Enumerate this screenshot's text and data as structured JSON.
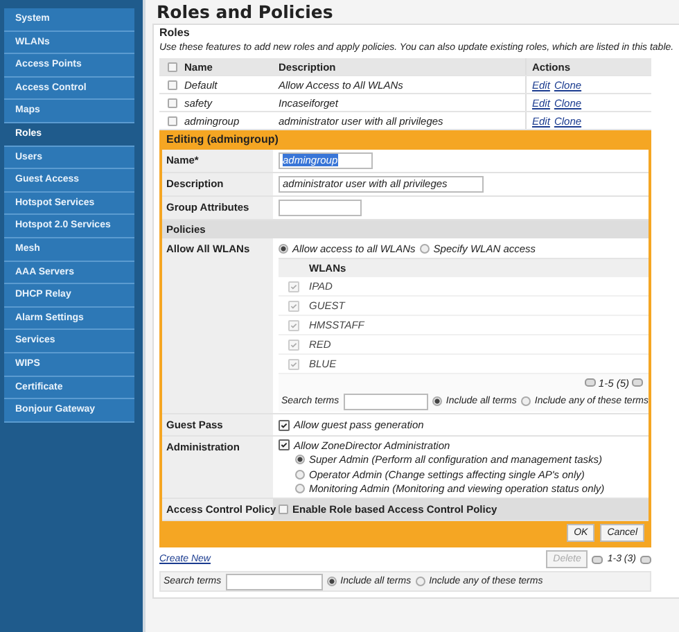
{
  "sidebar": {
    "items": [
      {
        "label": "System",
        "selected": false
      },
      {
        "label": "WLANs",
        "selected": false
      },
      {
        "label": "Access Points",
        "selected": false
      },
      {
        "label": "Access Control",
        "selected": false
      },
      {
        "label": "Maps",
        "selected": false
      },
      {
        "label": "Roles",
        "selected": true
      },
      {
        "label": "Users",
        "selected": false
      },
      {
        "label": "Guest Access",
        "selected": false
      },
      {
        "label": "Hotspot Services",
        "selected": false
      },
      {
        "label": "Hotspot 2.0 Services",
        "selected": false
      },
      {
        "label": "Mesh",
        "selected": false
      },
      {
        "label": "AAA Servers",
        "selected": false
      },
      {
        "label": "DHCP Relay",
        "selected": false
      },
      {
        "label": "Alarm Settings",
        "selected": false
      },
      {
        "label": "Services",
        "selected": false
      },
      {
        "label": "WIPS",
        "selected": false
      },
      {
        "label": "Certificate",
        "selected": false
      },
      {
        "label": "Bonjour Gateway",
        "selected": false
      }
    ]
  },
  "page_title": "Roles and Policies",
  "section_title": "Roles",
  "intro": "Use these features to add new roles and apply policies. You can also update existing roles, which are listed in this table.",
  "roles_table": {
    "columns": [
      "Name",
      "Description",
      "Actions"
    ],
    "header_checked": false,
    "rows": [
      {
        "checked": false,
        "name": "Default",
        "description": "Allow Access to All WLANs",
        "actions": [
          "Edit",
          "Clone"
        ]
      },
      {
        "checked": false,
        "name": "safety",
        "description": "Incaseiforget",
        "actions": [
          "Edit",
          "Clone"
        ]
      },
      {
        "checked": false,
        "name": "admingroup",
        "description": "administrator user with all privileges",
        "actions": [
          "Edit",
          "Clone"
        ]
      }
    ]
  },
  "editor": {
    "title": "Editing (admingroup)",
    "fields": [
      {
        "label": "Name*",
        "value": "admingroup",
        "kind": "selected"
      },
      {
        "label": "Description",
        "value": "administrator user with all privileges",
        "kind": "wide"
      },
      {
        "label": "Group Attributes",
        "kind": "short"
      }
    ],
    "policies_title": "Policies",
    "allow_all_label": "Allow All WLANs",
    "allow_options": [
      {
        "label": "Allow access to all WLANs",
        "selected": true
      },
      {
        "label": "Specify WLAN access",
        "selected": false
      }
    ],
    "wlans": {
      "column": "WLANs",
      "disabled": true,
      "rows": [
        {
          "name": "IPAD",
          "checked": true
        },
        {
          "name": "GUEST",
          "checked": true
        },
        {
          "name": "HMSSTAFF",
          "checked": true
        },
        {
          "name": "RED",
          "checked": true
        },
        {
          "name": "BLUE",
          "checked": true
        }
      ],
      "pager": "1-5 (5)",
      "search_label": "Search terms",
      "search_options": [
        {
          "label": "Include all terms",
          "selected": true
        },
        {
          "label": "Include any of these terms",
          "selected": false
        }
      ]
    },
    "guest_pass": {
      "label": "Guest Pass",
      "text": "Allow guest pass generation",
      "checked": true
    },
    "administration": {
      "label": "Administration",
      "text": "Allow ZoneDirector Administration",
      "checked": true,
      "options": [
        {
          "label": "Super Admin (Perform all configuration and management tasks)",
          "selected": true
        },
        {
          "label": "Operator Admin (Change settings affecting single AP's only)",
          "selected": false
        },
        {
          "label": "Monitoring Admin (Monitoring and viewing operation status only)",
          "selected": false
        }
      ]
    },
    "access_control": {
      "label": "Access Control Policy",
      "text": "Enable Role based Access Control Policy",
      "checked": false
    },
    "buttons": [
      "OK",
      "Cancel"
    ]
  },
  "create_new": "Create New",
  "delete_button": {
    "label": "Delete",
    "disabled": true
  },
  "pager": "1-3 (3)",
  "search": {
    "label": "Search terms",
    "options": [
      {
        "label": "Include all terms",
        "selected": true
      },
      {
        "label": "Include any of these terms",
        "selected": false
      }
    ]
  }
}
